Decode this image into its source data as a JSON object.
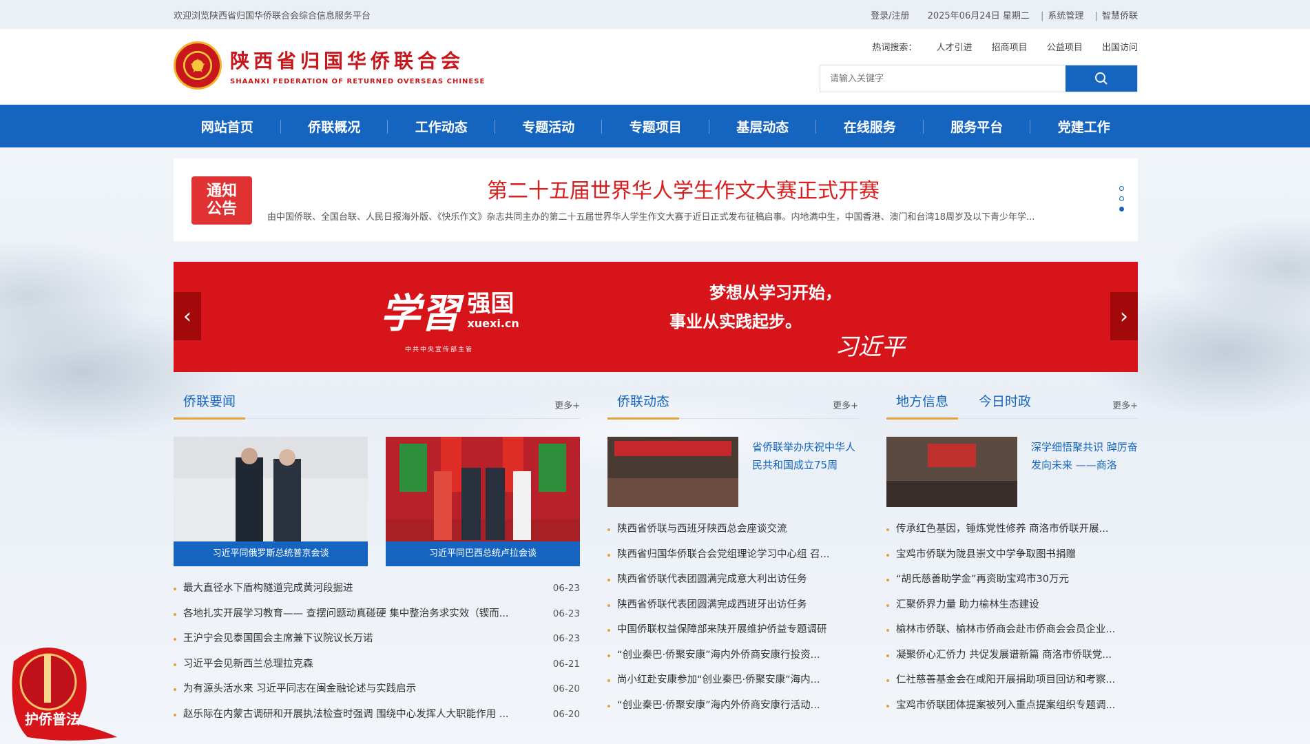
{
  "topbar": {
    "welcome": "欢迎浏览陕西省归国华侨联合会综合信息服务平台",
    "login": "登录/注册",
    "date": "2025年06月24日 星期二",
    "admin": "系统管理",
    "smart": "智慧侨联"
  },
  "header": {
    "org_cn": "陕西省归国华侨联合会",
    "org_en": "SHAANXI FEDERATION OF RETURNED OVERSEAS CHINESE",
    "hot_label": "热词搜索：",
    "hot_words": [
      "人才引进",
      "招商项目",
      "公益项目",
      "出国访问"
    ],
    "search_placeholder": "请输入关键字"
  },
  "nav": [
    "网站首页",
    "侨联概况",
    "工作动态",
    "专题活动",
    "专题项目",
    "基层动态",
    "在线服务",
    "服务平台",
    "党建工作"
  ],
  "notice": {
    "badge_line1": "通知",
    "badge_line2": "公告",
    "title": "第二十五届世界华人学生作文大赛正式开赛",
    "desc": "由中国侨联、全国台联、人民日报海外版、《快乐作文》杂志共同主办的第二十五届世界华人学生作文大赛于近日正式发布征稿启事。内地满中生，中国香港、澳门和台湾18周岁及以下青少年学..."
  },
  "banner": {
    "logo_big": "学習",
    "logo_strong": "强国",
    "logo_url": "xuexi.cn",
    "logo_sub": "中共中央宣传部主管",
    "slogan_line1": "梦想从学习开始，",
    "slogan_line2": "事业从实践起步。",
    "signature": "习近平"
  },
  "col1": {
    "title": "侨联要闻",
    "more": "更多+",
    "pics": [
      {
        "caption": "习近平同俄罗斯总统普京会谈"
      },
      {
        "caption": "习近平同巴西总统卢拉会谈"
      }
    ],
    "items": [
      {
        "text": "最大直径水下盾构隧道完成黄河段掘进",
        "date": "06-23"
      },
      {
        "text": "各地扎实开展学习教育—— 查摆问题动真碰硬 集中整治务求实效（锲而...",
        "date": "06-23"
      },
      {
        "text": "王沪宁会见泰国国会主席兼下议院议长万诺",
        "date": "06-23"
      },
      {
        "text": "习近平会见新西兰总理拉克森",
        "date": "06-21"
      },
      {
        "text": "为有源头活水来 习近平同志在闽金融论述与实践启示",
        "date": "06-20"
      },
      {
        "text": "赵乐际在内蒙古调研和开展执法检查时强调 围绕中心发挥人大职能作用 ...",
        "date": "06-20"
      }
    ]
  },
  "col2": {
    "title": "侨联动态",
    "more": "更多+",
    "thumb_title": "省侨联举办庆祝中华人民共和国成立75周",
    "items": [
      "陕西省侨联与西班牙陕西总会座谈交流",
      "陕西省归国华侨联合会党组理论学习中心组 召...",
      "陕西省侨联代表团圆满完成意大利出访任务",
      "陕西省侨联代表团圆满完成西班牙出访任务",
      "中国侨联权益保障部来陕开展维护侨益专题调研",
      "“创业秦巴·侨聚安康”海内外侨商安康行投资...",
      "尚小红赴安康参加“创业秦巴·侨聚安康”海内...",
      "“创业秦巴·侨聚安康”海内外侨商安康行活动..."
    ]
  },
  "col3": {
    "tab1": "地方信息",
    "tab2": "今日时政",
    "more": "更多+",
    "thumb_title": "深学细悟聚共识 踔厉奋发向未来 ——商洛",
    "items": [
      "传承红色基因，锤炼党性修养 商洛市侨联开展...",
      "宝鸡市侨联为陇县崇文中学争取图书捐赠",
      "“胡氏慈善助学金”再资助宝鸡市30万元",
      "汇聚侨界力量 助力榆林生态建设",
      "榆林市侨联、榆林市侨商会赴市侨商会会员企业...",
      "凝聚侨心汇侨力 共促发展谱新篇 商洛市侨联党...",
      "仁社慈善基金会在咸阳开展捐助项目回访和考察...",
      "宝鸡市侨联团体提案被列入重点提案组织专题调..."
    ]
  },
  "float": {
    "label": "护侨普法"
  },
  "colors": {
    "primary": "#1565c0",
    "red": "#d7141a",
    "accent": "#e3a33c"
  }
}
